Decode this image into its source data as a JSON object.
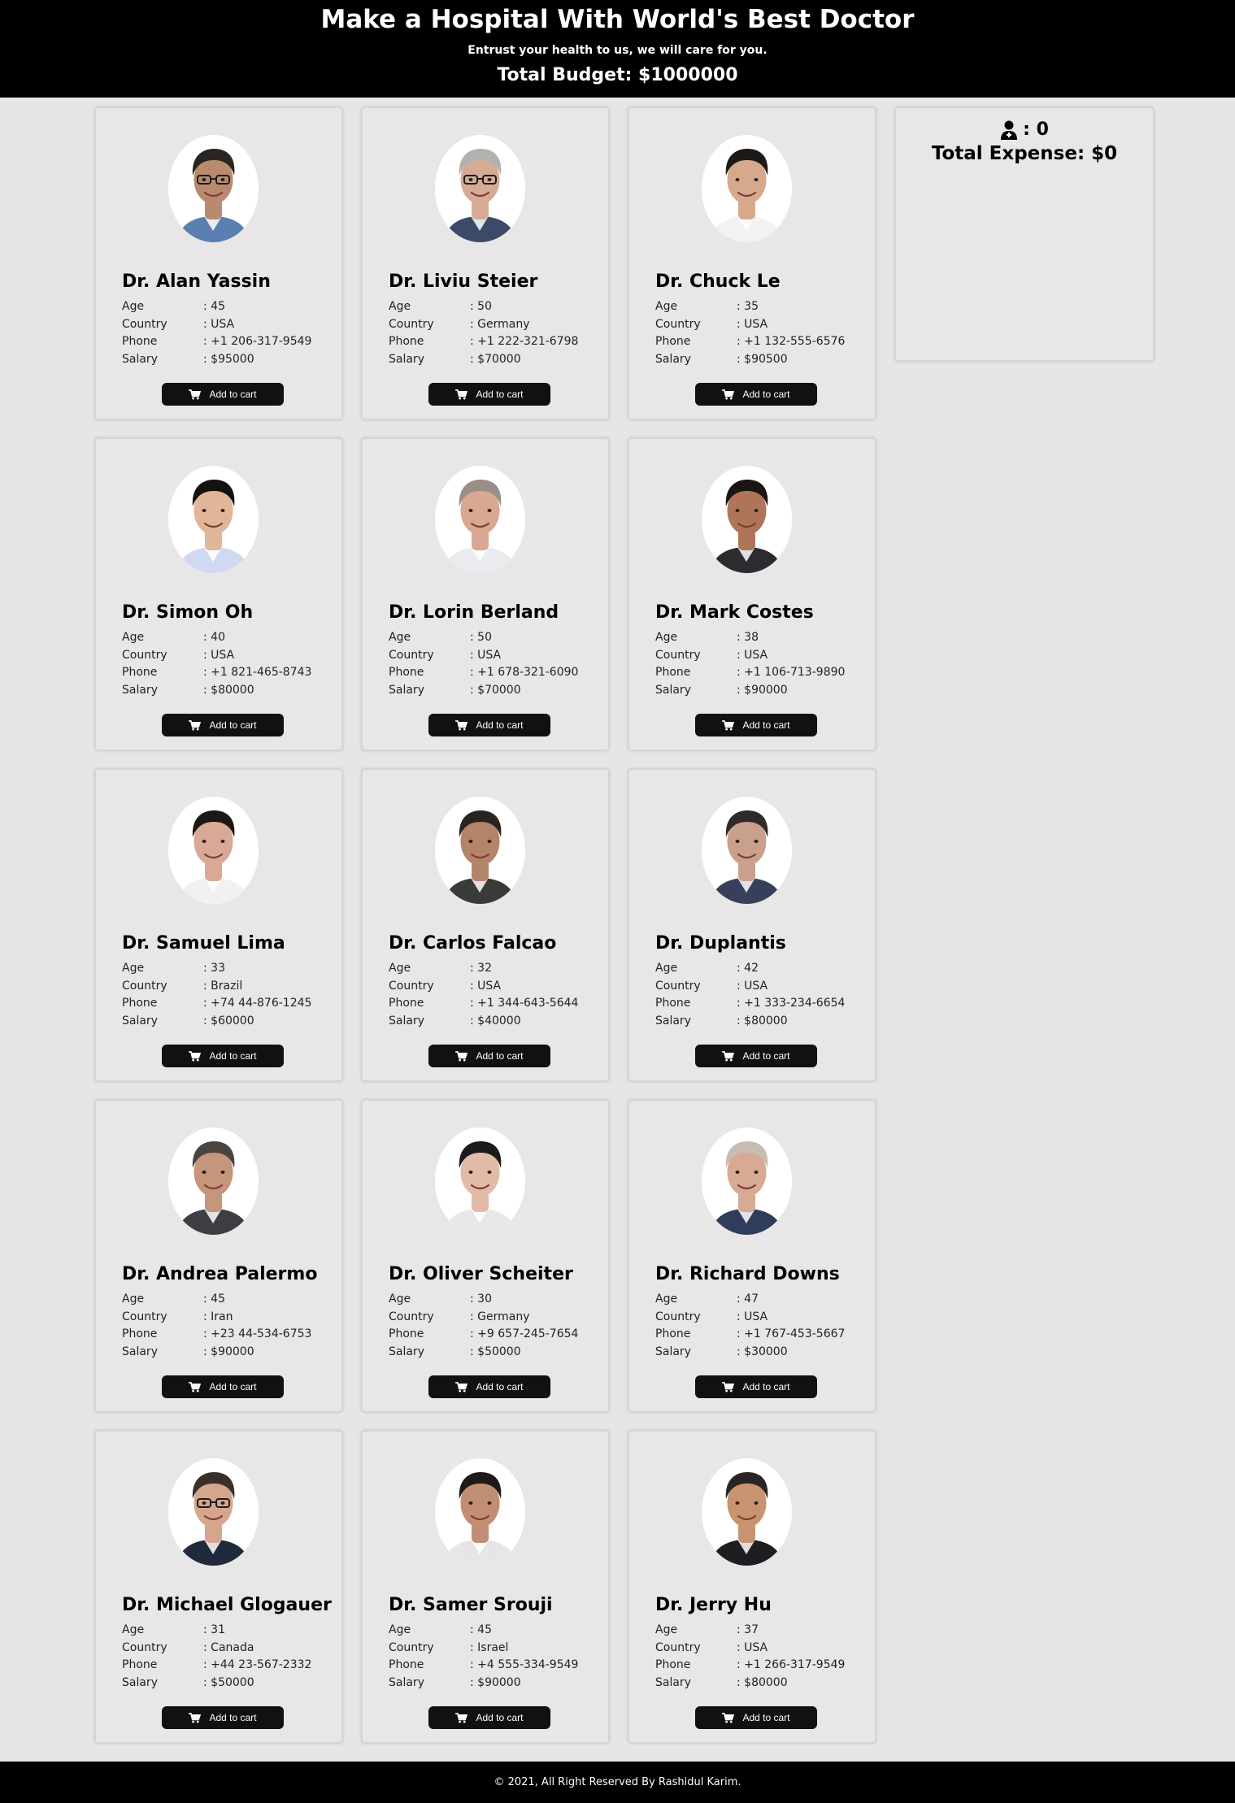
{
  "header": {
    "title": "Make a Hospital With World's Best Doctor",
    "subtitle": "Entrust your health to us, we will care for you.",
    "budget": "Total Budget: $1000000"
  },
  "labels": {
    "age": "Age",
    "country": "Country",
    "phone": "Phone",
    "salary": "Salary"
  },
  "button_label": "Add to cart",
  "cart": {
    "count": ": 0",
    "expense": "Total Expense: $0",
    "icon": "doctor-icon"
  },
  "doctors": [
    {
      "name": "Dr. Alan Yassin",
      "age": ": 45",
      "country": ": USA",
      "phone": ": +1 206-317-9549",
      "salary": ": $95000",
      "skin": "#b98a6e",
      "hair": "#2b2521",
      "shirt": "#5a7fb0",
      "glasses": true
    },
    {
      "name": "Dr. Liviu Steier",
      "age": ": 50",
      "country": ": Germany",
      "phone": ": +1 222-321-6798",
      "salary": ": $70000",
      "skin": "#d6ab95",
      "hair": "#b3b1ad",
      "shirt": "#3b4a66",
      "glasses": true
    },
    {
      "name": "Dr. Chuck Le",
      "age": ": 35",
      "country": ": USA",
      "phone": ": +1 132-555-6576",
      "salary": ": $90500",
      "skin": "#d7a98c",
      "hair": "#1d1916",
      "shirt": "#f2f2f2",
      "glasses": false
    },
    {
      "name": "Dr. Simon Oh",
      "age": ": 40",
      "country": ": USA",
      "phone": ": +1 821-465-8743",
      "salary": ": $80000",
      "skin": "#e0b598",
      "hair": "#141210",
      "shirt": "#cfdaf0",
      "glasses": false
    },
    {
      "name": "Dr. Lorin Berland",
      "age": ": 50",
      "country": ": USA",
      "phone": ": +1 678-321-6090",
      "salary": ": $70000",
      "skin": "#d9a792",
      "hair": "#9a8f86",
      "shirt": "#eaeaf0",
      "glasses": false
    },
    {
      "name": "Dr. Mark Costes",
      "age": ": 38",
      "country": ": USA",
      "phone": ": +1 106-713-9890",
      "salary": ": $90000",
      "skin": "#b07558",
      "hair": "#1a1512",
      "shirt": "#2c2c30",
      "glasses": false
    },
    {
      "name": "Dr. Samuel Lima",
      "age": ": 33",
      "country": ": Brazil",
      "phone": ": +74 44-876-1245",
      "salary": ": $60000",
      "skin": "#d9a995",
      "hair": "#1c1815",
      "shirt": "#f1f1f1",
      "glasses": false
    },
    {
      "name": "Dr. Carlos Falcao",
      "age": ": 32",
      "country": ": USA",
      "phone": ": +1 344-643-5644",
      "salary": ": $40000",
      "skin": "#b3846a",
      "hair": "#2a2420",
      "shirt": "#3a3a36",
      "glasses": false
    },
    {
      "name": "Dr. Duplantis",
      "age": ": 42",
      "country": ": USA",
      "phone": ": +1 333-234-6654",
      "salary": ": $80000",
      "skin": "#c9a08c",
      "hair": "#2e2a28",
      "shirt": "#36405a",
      "glasses": false
    },
    {
      "name": "Dr. Andrea Palermo",
      "age": ": 45",
      "country": ": Iran",
      "phone": ": +23 44-534-6753",
      "salary": ": $90000",
      "skin": "#c5957c",
      "hair": "#4a4440",
      "shirt": "#3c3e44",
      "glasses": false
    },
    {
      "name": "Dr. Oliver Scheiter",
      "age": ": 30",
      "country": ": Germany",
      "phone": ": +9 657-245-7654",
      "salary": ": $50000",
      "skin": "#e1bba8",
      "hair": "#1c1a18",
      "shirt": "#e8e8e8",
      "glasses": false
    },
    {
      "name": "Dr. Richard Downs",
      "age": ": 47",
      "country": ": USA",
      "phone": ": +1 767-453-5667",
      "salary": ": $30000",
      "skin": "#d8a993",
      "hair": "#c7bcb2",
      "shirt": "#2f3c5c",
      "glasses": false
    },
    {
      "name": "Dr. Michael Glogauer",
      "age": ": 31",
      "country": ": Canada",
      "phone": ": +44 23-567-2332",
      "salary": ": $50000",
      "skin": "#d6a58e",
      "hair": "#3a302a",
      "shirt": "#1f2a3a",
      "glasses": true
    },
    {
      "name": "Dr. Samer Srouji",
      "age": ": 45",
      "country": ": Israel",
      "phone": ": +4 555-334-9549",
      "salary": ": $90000",
      "skin": "#c18e74",
      "hair": "#1e1a17",
      "shirt": "#e6e6e6",
      "glasses": false
    },
    {
      "name": "Dr. Jerry Hu",
      "age": ": 37",
      "country": ": USA",
      "phone": ": +1 266-317-9549",
      "salary": ": $80000",
      "skin": "#c8946f",
      "hair": "#2a2522",
      "shirt": "#1e1e22",
      "glasses": false
    }
  ],
  "footer": {
    "text": "© 2021, All Right Reserved By Rashidul Karim."
  }
}
